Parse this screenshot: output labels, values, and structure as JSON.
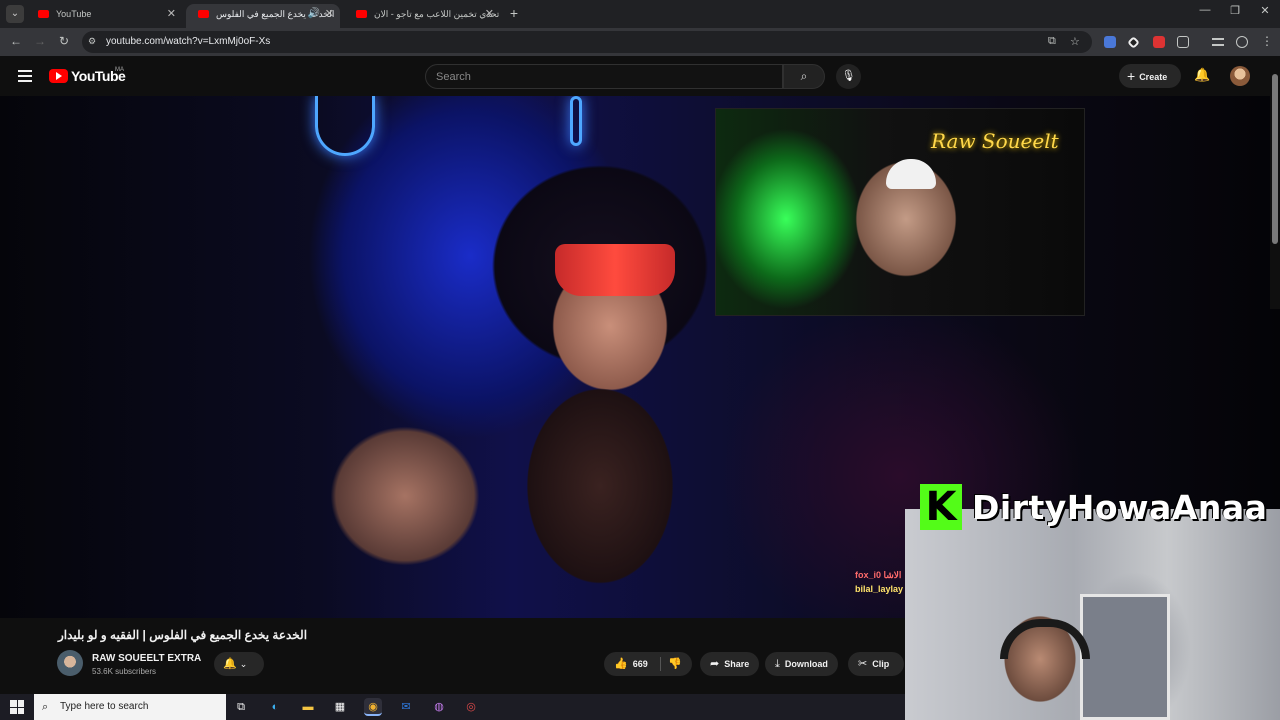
{
  "browser": {
    "tabs": [
      {
        "title": "YouTube",
        "active": false
      },
      {
        "title": "الخدعة يخدع الجميع في الفلوس",
        "active": true
      },
      {
        "title": "تحدي تخمين اللاعب مع تاجو - الان",
        "active": false
      }
    ],
    "url": "youtube.com/watch?v=LxmMj0oF-Xs"
  },
  "youtube": {
    "logo_text": "YouTube",
    "country_code": "MA",
    "search_placeholder": "Search",
    "create_label": "Create"
  },
  "video": {
    "inset_sign": "Raw Soueelt",
    "chat_names": [
      "fox_i0 الاشا",
      "bilal_laylay"
    ],
    "overlay_name": "DirtyHowaAnaa",
    "overlay_logo_letter": "K"
  },
  "meta": {
    "title": "الخدعة يخدع الجميع في الفلوس | الفقيه و لو بليدار",
    "channel_name": "RAW SOUEELT EXTRA",
    "subscribers": "53.6K subscribers",
    "likes": "669",
    "share_label": "Share",
    "download_label": "Download",
    "clip_label": "Clip"
  },
  "taskbar": {
    "search_placeholder": "Type here to search"
  },
  "colors": {
    "youtube_red": "#ff0000",
    "kick_green": "#53fc18",
    "page_bg": "#0f0f0f"
  }
}
